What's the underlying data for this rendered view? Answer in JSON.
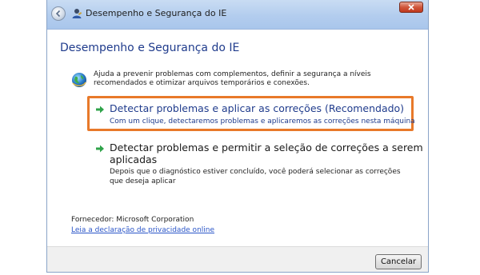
{
  "window": {
    "title": "Desempenho e Segurança do IE"
  },
  "main": {
    "heading": "Desempenho e Segurança do IE",
    "description": "Ajuda a prevenir problemas com complementos, definir a segurança a níveis recomendados e otimizar arquivos temporários e conexões.",
    "options": [
      {
        "title": "Detectar problemas e aplicar as correções (Recomendado)",
        "subtitle": "Com um clique, detectaremos problemas e aplicaremos as correções nesta máquina"
      },
      {
        "title_line1": "Detectar problemas e permitir a seleção de correções a serem",
        "title_line2": "aplicadas",
        "subtitle": "Depois que o diagnóstico estiver concluído, você poderá selecionar as correções que deseja aplicar"
      }
    ],
    "vendor": "Fornecedor: Microsoft Corporation",
    "privacy_link": "Leia a declaração de privacidade online"
  },
  "footer": {
    "cancel_label": "Cancelar"
  },
  "colors": {
    "heading": "#1f3b8c",
    "highlight_border": "#e8792a",
    "arrow": "#2fa34a",
    "link": "#2a55c8"
  },
  "icons": {
    "back": "back-arrow-icon",
    "app": "tools-person-icon",
    "description": "globe-icon",
    "option": "green-arrow-icon",
    "close": "close-icon"
  }
}
